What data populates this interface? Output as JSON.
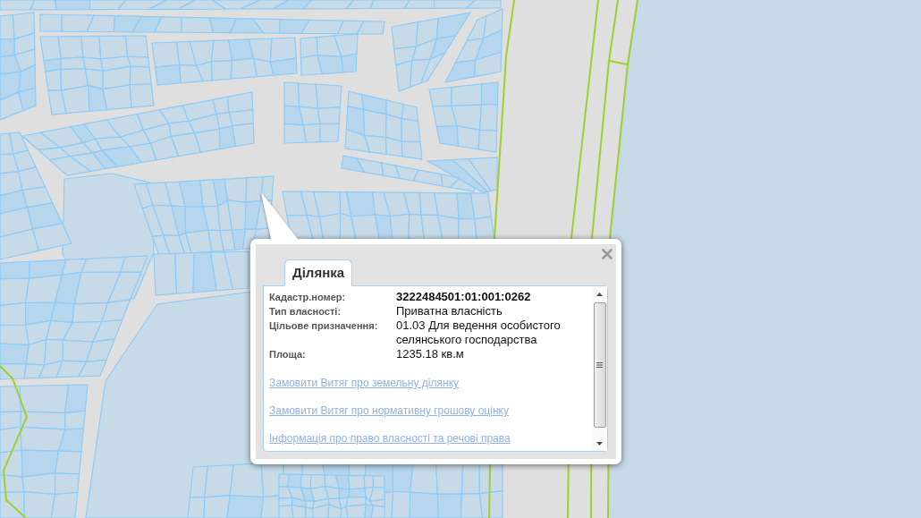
{
  "popup": {
    "tabs": [
      {
        "label": "Ділянка",
        "selected": true
      }
    ],
    "fields": [
      {
        "label": "Кадастр.номер:",
        "value": "3222484501:01:001:0262",
        "kind": "key"
      },
      {
        "label": "Тип власності:",
        "value": "Приватна власність",
        "kind": "text"
      },
      {
        "label": "Цільове призначення:",
        "value": "01.03 Для ведення особистого селянського господарства",
        "kind": "text"
      },
      {
        "label": "Площа:",
        "value": "1235.18 кв.м",
        "kind": "text"
      }
    ],
    "links": [
      "Замовити Витяг про земельну ділянку",
      "Замовити Витяг про нормативну грошову оцінку",
      "Інформація про право власності та речові права"
    ]
  }
}
